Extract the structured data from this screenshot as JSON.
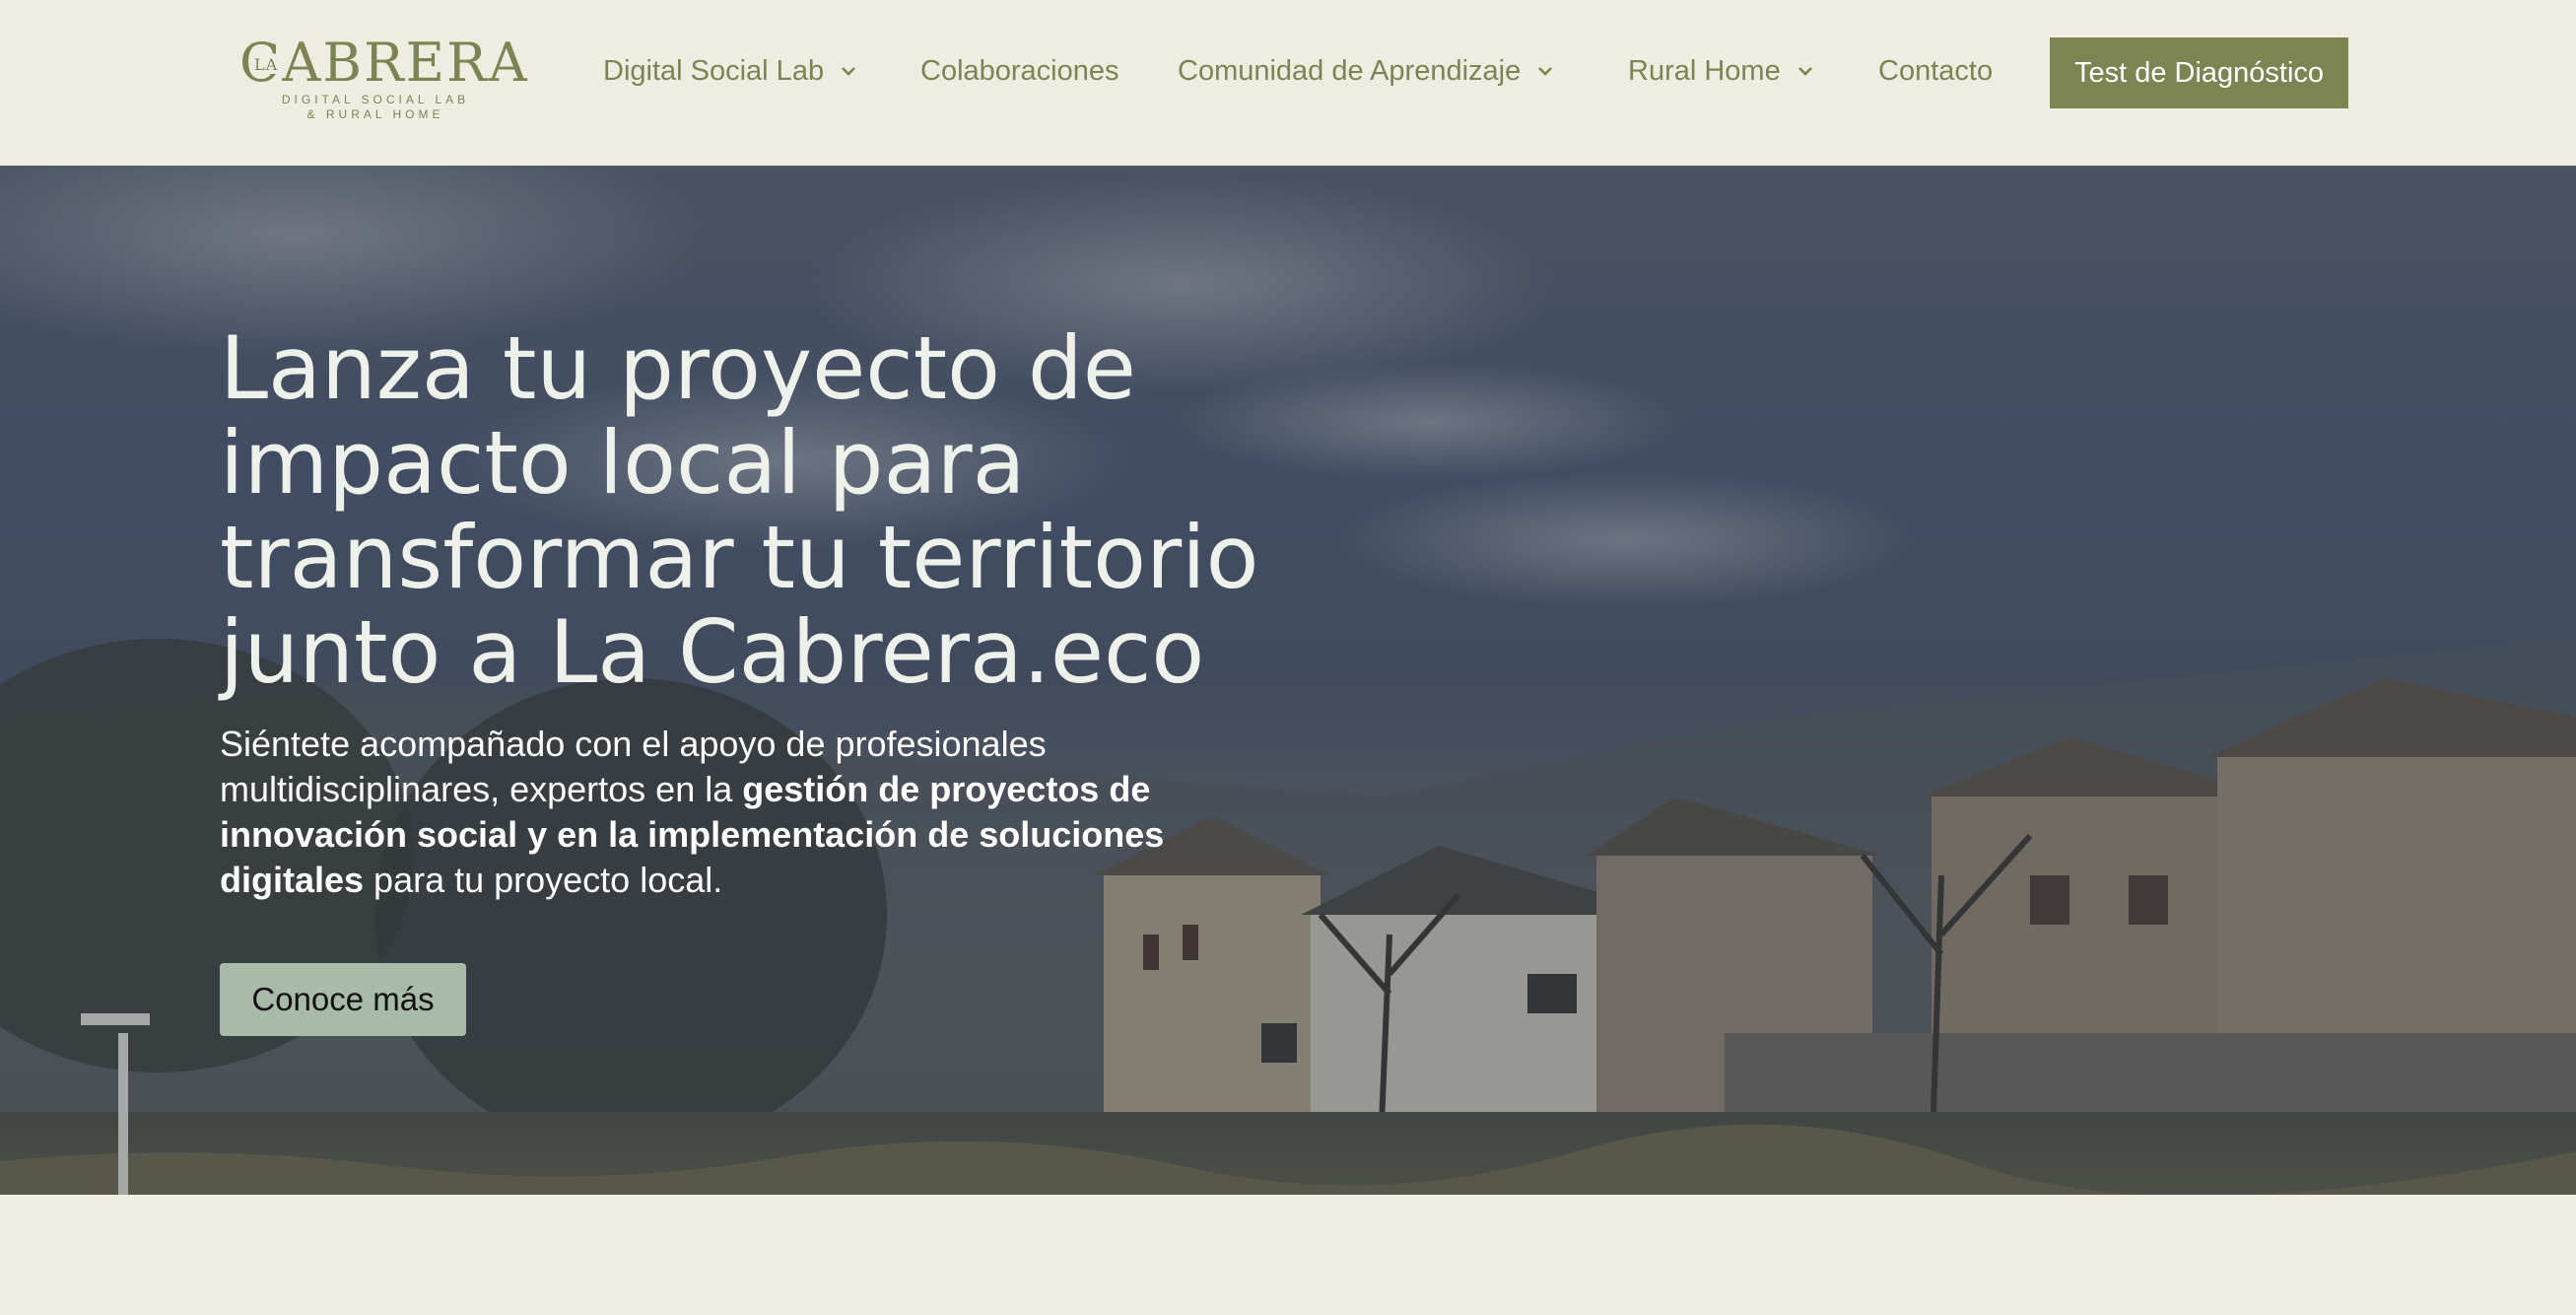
{
  "header": {
    "logo": {
      "wordmark": "CABRERA",
      "prefix": "LA",
      "tagline_line1": "DIGITAL SOCIAL LAB",
      "tagline_line2": "& RURAL HOME"
    },
    "nav": [
      {
        "label": "Digital Social Lab",
        "has_dropdown": true,
        "icon": "chevron-down-icon"
      },
      {
        "label": "Colaboraciones",
        "has_dropdown": false
      },
      {
        "label": "Comunidad de Aprendizaje",
        "has_dropdown": true,
        "icon": "chevron-down-icon"
      },
      {
        "label": "Rural Home",
        "has_dropdown": true,
        "icon": "chevron-down-icon"
      },
      {
        "label": "Contacto",
        "has_dropdown": false
      }
    ],
    "cta_label": "Test de Diagnóstico"
  },
  "hero": {
    "title": "Lanza tu proyecto de impacto local para transformar tu territorio junto a La Cabrera.eco",
    "subtitle": {
      "part1": "Siéntete acompañado con el apoyo de profesionales multidisciplinares, expertos en la ",
      "bold": "gestión de proyectos de innovación social y en la implementación de soluciones digitales",
      "part2": " para tu proyecto local."
    },
    "button_label": "Conoce más",
    "background_image": "village-landscape"
  },
  "colors": {
    "accent": "#7c8552",
    "page_background": "#efece2",
    "hero_button": "#a8bba8",
    "cta_text": "#ffffff"
  }
}
